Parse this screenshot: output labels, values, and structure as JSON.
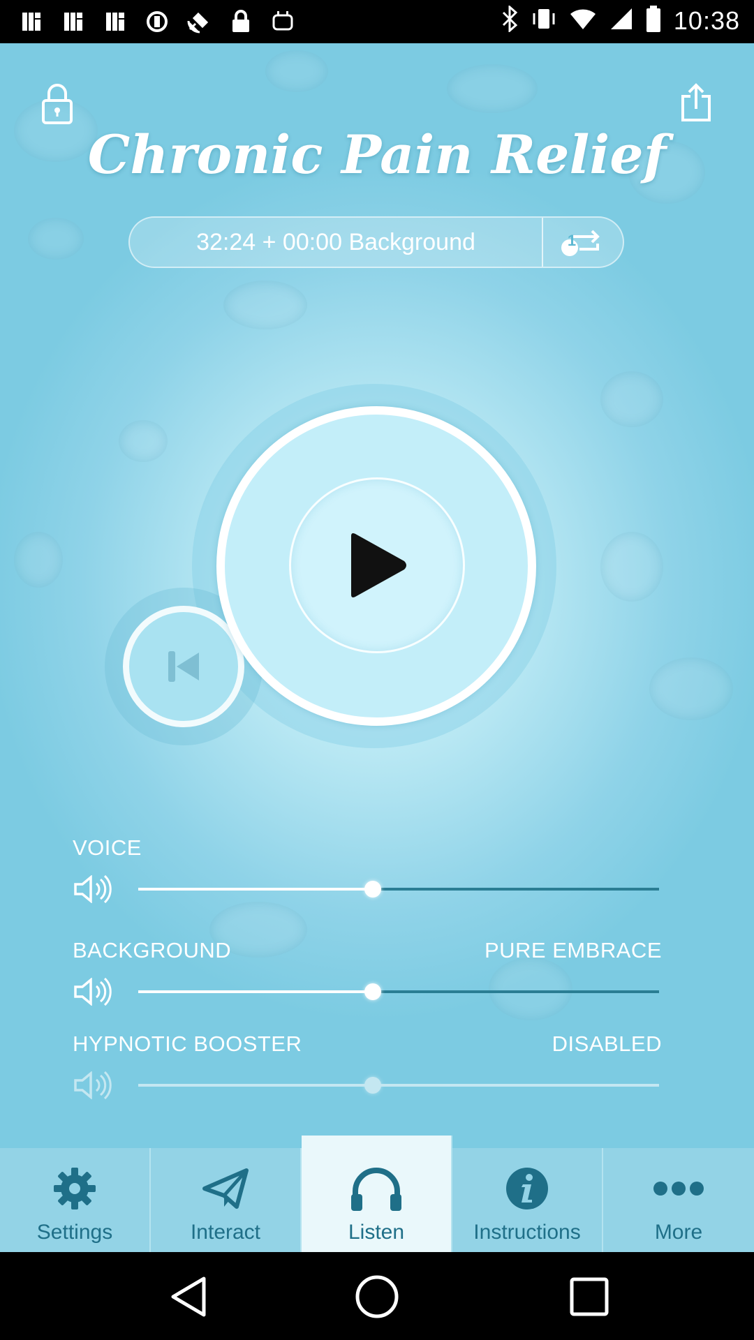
{
  "status_bar": {
    "time": "10:38",
    "left_icons": [
      "nfc-icon",
      "nfc-icon",
      "nfc-icon",
      "sync-icon",
      "satellite-icon",
      "lock-icon",
      "android-icon"
    ],
    "right_icons": [
      "bluetooth-icon",
      "vibrate-icon",
      "wifi-icon",
      "signal-icon",
      "battery-icon"
    ]
  },
  "header": {
    "title": "Chronic Pain Relief",
    "lock_icon": "lock-icon",
    "share_icon": "share-icon"
  },
  "session": {
    "time_text": "32:24 + 00:00 Background",
    "repeat_count": "1",
    "repeat_icon": "repeat-icon"
  },
  "player": {
    "play_icon": "play-icon",
    "previous_icon": "skip-back-icon"
  },
  "sliders": {
    "voice": {
      "label": "VOICE",
      "value_label": "",
      "level": 0.45
    },
    "background": {
      "label": "BACKGROUND",
      "value_label": "PURE EMBRACE",
      "level": 0.45
    },
    "hypnotic_booster": {
      "label": "HYPNOTIC BOOSTER",
      "value_label": "DISABLED",
      "level": 0.45,
      "enabled": false
    }
  },
  "tabs": [
    {
      "label": "Settings",
      "icon": "gear-icon",
      "active": false
    },
    {
      "label": "Interact",
      "icon": "send-icon",
      "active": false
    },
    {
      "label": "Listen",
      "icon": "headphones-icon",
      "active": true
    },
    {
      "label": "Instructions",
      "icon": "info-icon",
      "active": false
    },
    {
      "label": "More",
      "icon": "more-icon",
      "active": false
    }
  ],
  "colors": {
    "background": "#8fd3e8",
    "tab_bar": "#93d3e6",
    "tab_active": "#eaf8fb",
    "tab_text": "#1f6f88",
    "slider_rest": "#2a7d93"
  },
  "navigation": [
    "back-icon",
    "home-icon",
    "recents-icon"
  ]
}
